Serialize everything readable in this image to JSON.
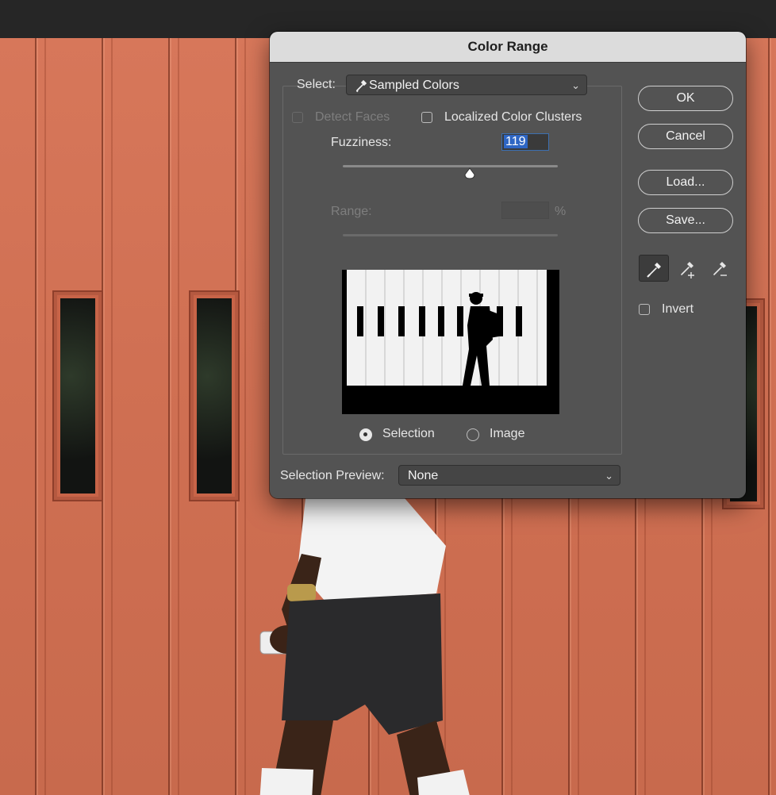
{
  "dialog": {
    "title": "Color Range",
    "select": {
      "label": "Select:",
      "value": "Sampled Colors",
      "icon": "eyedropper-icon"
    },
    "detect_faces": {
      "label": "Detect Faces",
      "checked": false,
      "enabled": false
    },
    "localized_clusters": {
      "label": "Localized Color Clusters",
      "checked": false
    },
    "fuzziness": {
      "label": "Fuzziness:",
      "value": "119",
      "slider_fraction": 0.59
    },
    "range": {
      "label": "Range:",
      "value": "",
      "unit": "%",
      "enabled": false
    },
    "preview_mode": {
      "options": [
        {
          "label": "Selection",
          "checked": true
        },
        {
          "label": "Image",
          "checked": false
        }
      ]
    },
    "selection_preview": {
      "label": "Selection Preview:",
      "value": "None"
    },
    "buttons": {
      "ok": "OK",
      "cancel": "Cancel",
      "load": "Load...",
      "save": "Save..."
    },
    "tools": [
      "eyedropper-icon",
      "eyedropper-plus-icon",
      "eyedropper-minus-icon"
    ],
    "invert": {
      "label": "Invert",
      "checked": false
    }
  },
  "colors": {
    "dialog_bg": "#535353",
    "title_bg": "#dcdcdc",
    "highlight": "#2e66c4",
    "wall": "#cf6f52"
  }
}
